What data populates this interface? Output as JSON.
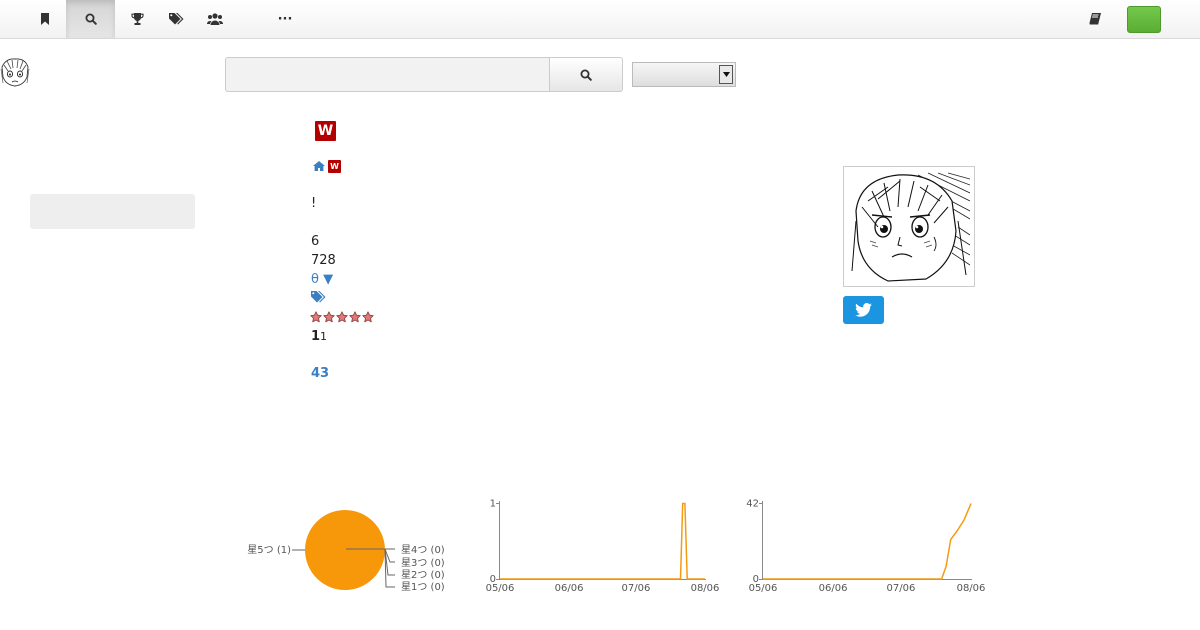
{
  "nav": {
    "icons": [
      "bookmark-icon",
      "search-icon",
      "trophy-icon",
      "tags-icon",
      "users-icon",
      "more-icon",
      "book-icon"
    ],
    "more_label": "···",
    "active_item": "search-icon",
    "accent_color": "#5cb335"
  },
  "search": {
    "input_value": "",
    "placeholder": "",
    "select_value": ""
  },
  "article": {
    "title_badge": "W",
    "breadcrumb_badge": "W",
    "exclamation": "!",
    "count_a": "6",
    "count_b": "728",
    "theta_link": "θ ▼",
    "star_count": 5,
    "rating_bold": "1",
    "rating_small": "1",
    "link_number": "43",
    "badge_color": "#b50000",
    "link_color": "#3a7fc1"
  },
  "share": {
    "twitter_icon": "twitter-icon",
    "twitter_color": "#1b95e0"
  },
  "chart_data": [
    {
      "type": "pie",
      "slices": [
        {
          "label": "星5つ (1)",
          "value": 1
        },
        {
          "label": "星4つ (0)",
          "value": 0
        },
        {
          "label": "星3つ (0)",
          "value": 0
        },
        {
          "label": "星2つ (0)",
          "value": 0
        },
        {
          "label": "星1つ (0)",
          "value": 0
        }
      ],
      "color": "#f7980a"
    },
    {
      "type": "line",
      "x_ticks": [
        "05/06",
        "06/06",
        "07/06",
        "08/06"
      ],
      "y_ticks": [
        "0",
        "1"
      ],
      "ylim": [
        0,
        1
      ],
      "points": [
        {
          "x": "05/06",
          "y": 0
        },
        {
          "x": "07/26",
          "y": 0
        },
        {
          "x": "07/27",
          "y": 1
        },
        {
          "x": "07/28",
          "y": 1
        },
        {
          "x": "07/29",
          "y": 0
        },
        {
          "x": "08/06",
          "y": 0
        }
      ],
      "color": "#f39c12"
    },
    {
      "type": "line",
      "x_ticks": [
        "05/06",
        "06/06",
        "07/06",
        "08/06"
      ],
      "y_ticks": [
        "0",
        "42"
      ],
      "ylim": [
        0,
        42
      ],
      "points": [
        {
          "x": "05/06",
          "y": 0
        },
        {
          "x": "07/24",
          "y": 0
        },
        {
          "x": "07/26",
          "y": 7
        },
        {
          "x": "07/28",
          "y": 22
        },
        {
          "x": "07/31",
          "y": 27
        },
        {
          "x": "08/03",
          "y": 33
        },
        {
          "x": "08/06",
          "y": 42
        }
      ],
      "color": "#f39c12"
    }
  ]
}
